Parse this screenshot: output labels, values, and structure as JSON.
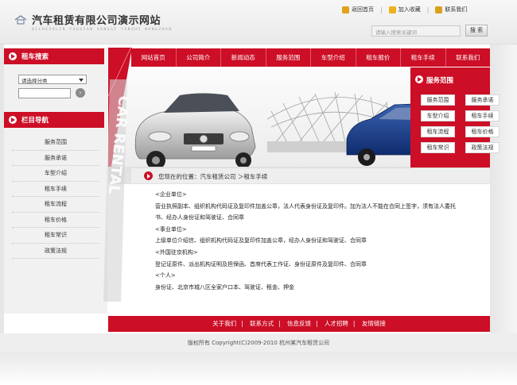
{
  "header": {
    "title": "汽车租赁有限公司演示网站",
    "subtitle": "QICHEZULIN YOUXIAN GONGSI YANSHI WANGZHAN",
    "toplinks": [
      {
        "label": "返回首页",
        "icon": "home-icon",
        "color": "#e0a21a"
      },
      {
        "label": "加入收藏",
        "icon": "favorite-icon",
        "color": "#f0b21c"
      },
      {
        "label": "联系我们",
        "icon": "contact-icon",
        "color": "#d9a21c"
      }
    ],
    "search_placeholder": "请输入搜索关键词",
    "search_button": "搜 索"
  },
  "sidebar": {
    "search_title": "租车搜索",
    "select_value": "请选择分类",
    "nav_title": "栏目导航",
    "nav_items": [
      "服务范围",
      "服务承诺",
      "车型介绍",
      "租车手续",
      "租车流程",
      "租车价格",
      "租车常识",
      "政策法规"
    ]
  },
  "menu": [
    "网站首页",
    "公司简介",
    "新闻动态",
    "服务范围",
    "车型介绍",
    "租车报价",
    "租车手续",
    "联系我们"
  ],
  "services": {
    "title": "服务范围",
    "items": [
      "服务范围",
      "服务承诺",
      "车型介绍",
      "租车手续",
      "租车流程",
      "租车价格",
      "租车常识",
      "政策法规"
    ]
  },
  "breadcrumb": {
    "text": "您现在的位置：汽车租赁公司 ＞租车手续"
  },
  "content": {
    "lines": [
      "<企业单位>",
      "营业执照副本、组织机构代码证及复印件加盖公章，法人代表身份证及复印件。加为法人不能在合同上签字，须有法人委托",
      "书、经办人身份证和驾驶证、合同章",
      "<事业单位>",
      "上级单位介绍信、组织机构代码证及复印件加盖公章，经办人身份证和驾驶证、合同章",
      "<外国驻京机构>",
      "登记证原件、派出机构证明及担保函、首席代表工作证、身份证原件及复印件、合同章",
      "<个人>",
      "身份证、北京市城八区全家户口本、驾驶证、租金、押金"
    ]
  },
  "footer": {
    "links": [
      "关于我们",
      "联系方式",
      "信息反馈",
      "人才招聘",
      "友情链接"
    ],
    "separator": "|",
    "copyright": "版权所有  Copyright(C)2009-2010 杭州某汽车租赁公司"
  },
  "colors": {
    "accent": "#cc0e26"
  }
}
